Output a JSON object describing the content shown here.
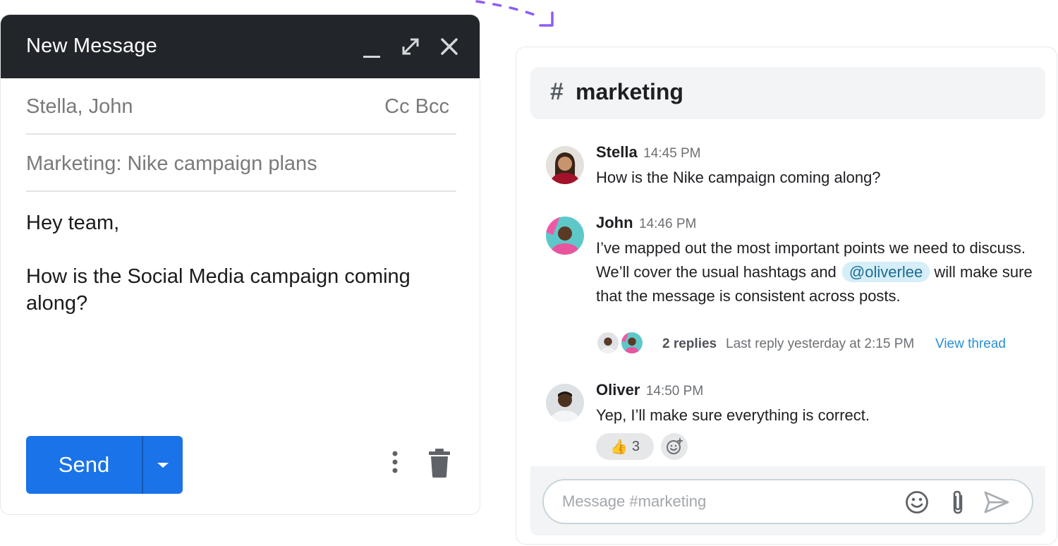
{
  "compose": {
    "title": "New Message",
    "to_value": "Stella, John",
    "cc_bcc": "Cc Bcc",
    "subject_value": "Marketing: Nike campaign plans",
    "greeting": "Hey team,",
    "body": "How is the Social Media campaign coming along?",
    "send_label": "Send"
  },
  "chat": {
    "channel_hash": "#",
    "channel_name": "marketing",
    "messages": [
      {
        "author": "Stella",
        "time": "14:45 PM",
        "text": "How is the Nike campaign coming along?"
      },
      {
        "author": "John",
        "time": "14:46 PM",
        "text_before": "I’ve mapped out the most important points we need to discuss. We’ll cover the usual hashtags and",
        "mention": "@oliverlee",
        "text_after": "will make sure that the message is consistent across posts."
      },
      {
        "author": "Oliver",
        "time": "14:50 PM",
        "text": "Yep, I’ll make sure everything is correct."
      }
    ],
    "thread": {
      "replies": "2 replies",
      "last_reply": "Last reply yesterday at 2:15 PM",
      "view_thread": "View thread"
    },
    "reaction": {
      "emoji": "👍",
      "count": "3"
    },
    "input_placeholder": "Message #marketing"
  },
  "colors": {
    "header_bg": "#22262b",
    "send_button": "#1a73e8",
    "link": "#2a8fd6",
    "mention_bg": "#d5eef7",
    "accent_arrow": "#8b5cf6"
  },
  "icons": [
    "minimize-icon",
    "expand-icon",
    "close-icon",
    "dropdown-caret-icon",
    "more-vertical-icon",
    "trash-icon",
    "hash-icon",
    "thumbs-up-icon",
    "add-reaction-icon",
    "emoji-icon",
    "paperclip-icon",
    "send-arrow-icon"
  ]
}
